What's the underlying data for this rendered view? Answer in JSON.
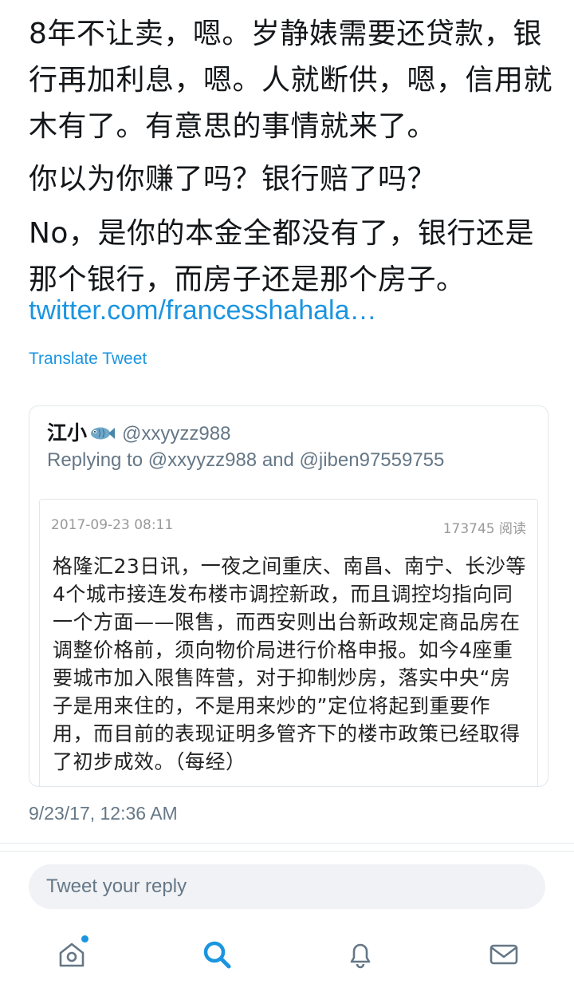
{
  "tweet": {
    "paragraphs": [
      "8年不让卖，嗯。岁静婊需要还贷款，银行再加利息，嗯。人就断供，嗯，信用就木有了。有意思的事情就来了。",
      "你以为你赚了吗？银行赔了吗？",
      "No，是你的本金全都没有了，银行还是那个银行，而房子还是那个房子。"
    ],
    "link_text": "twitter.com/francesshahala…",
    "translate_label": "Translate Tweet",
    "timestamp": "9/23/17, 12:36 AM"
  },
  "quoted_tweet": {
    "name": "江小",
    "name_icon": "fish-icon",
    "handle": "@xxyyzz988",
    "replying_to": "Replying to @xxyyzz988 and @jiben97559755",
    "article": {
      "date": "2017-09-23 08:11",
      "reads": "173745 阅读",
      "body": "格隆汇23日讯，一夜之间重庆、南昌、南宁、长沙等4个城市接连发布楼市调控新政，而且调控均指向同一个方面——限售，而西安则出台新政规定商品房在调整价格前，须向物价局进行价格申报。如今4座重要城市加入限售阵营，对于抑制炒房，落实中央“房子是用来住的，不是用来炒的”定位将起到重要作用，而目前的表现证明多管齐下的楼市政策已经取得了初步成效。（每经）"
    }
  },
  "reply": {
    "placeholder": "Tweet your reply"
  },
  "tabbar": {
    "items": [
      "home-icon",
      "search-icon",
      "notifications-icon",
      "messages-icon"
    ],
    "active": "search-icon",
    "accent_color": "#1b95e0",
    "icon_color": "#657786"
  }
}
